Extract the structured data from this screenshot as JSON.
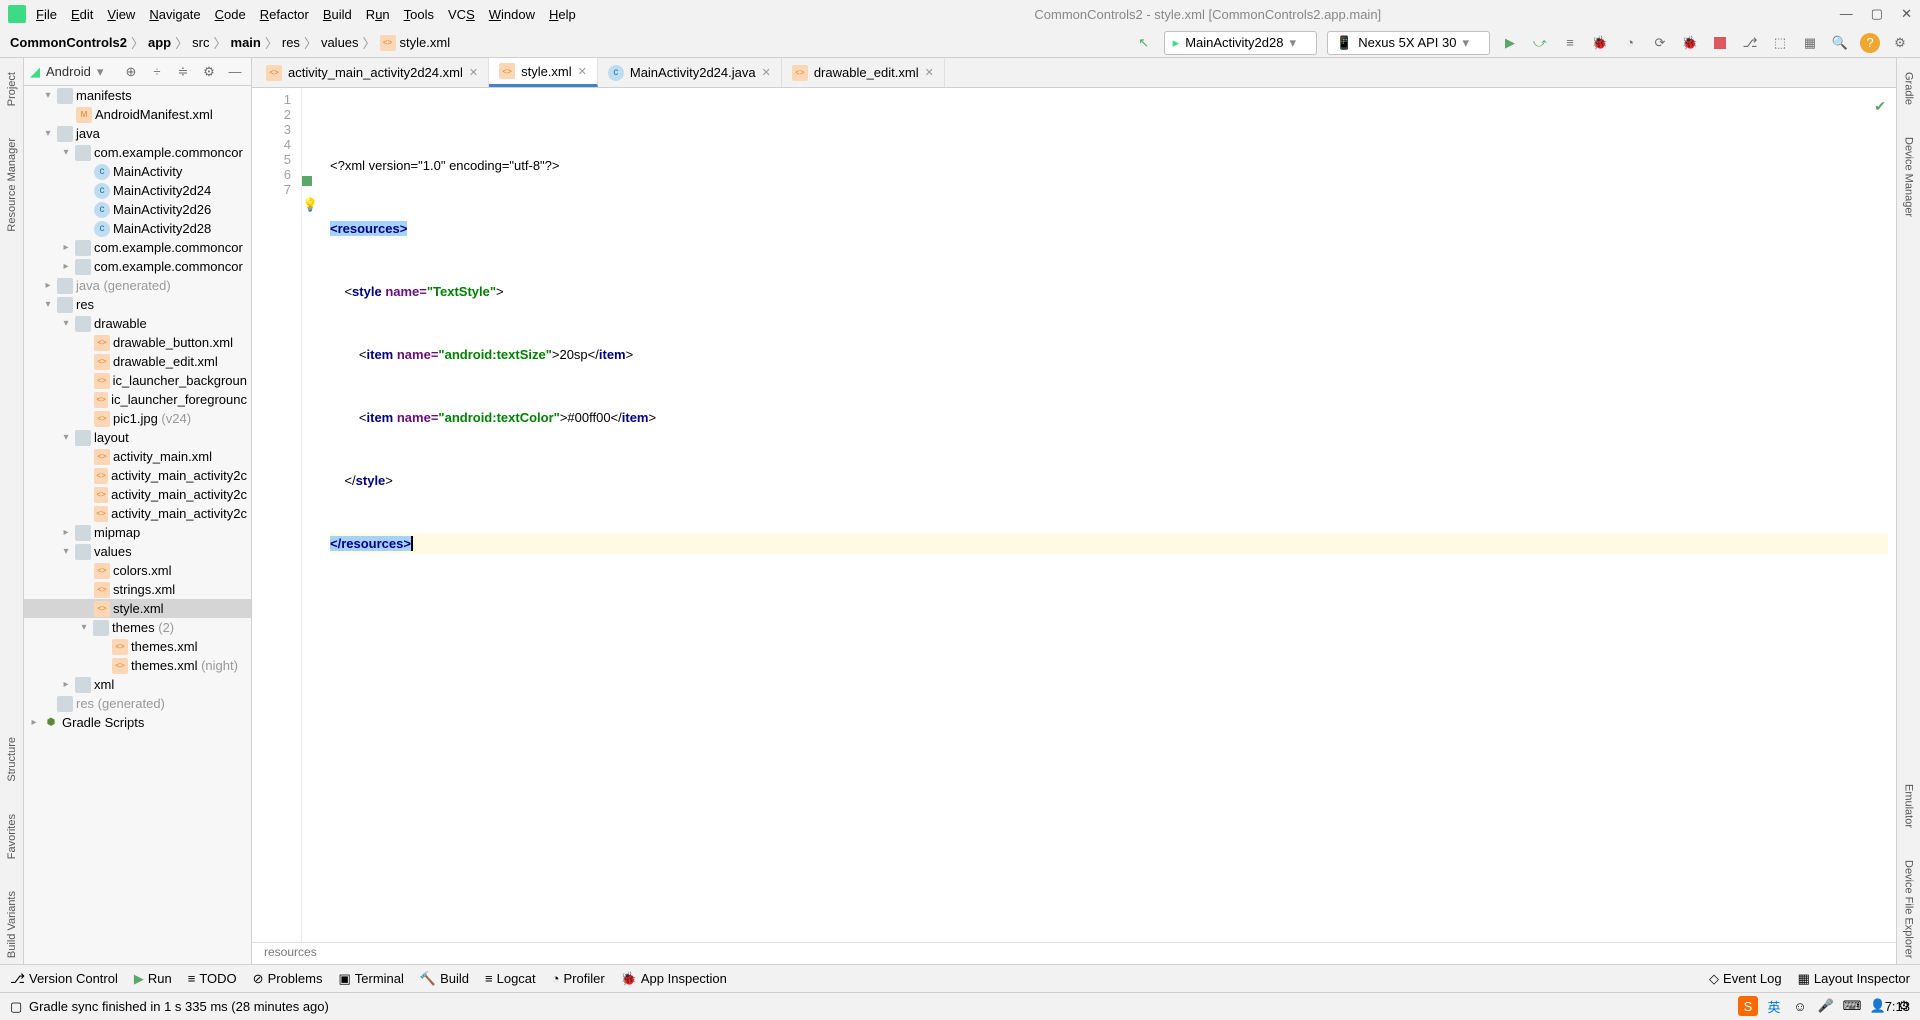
{
  "menu": [
    "File",
    "Edit",
    "View",
    "Navigate",
    "Code",
    "Refactor",
    "Build",
    "Run",
    "Tools",
    "VCS",
    "Window",
    "Help"
  ],
  "title": "CommonControls2 - style.xml [CommonControls2.app.main]",
  "breadcrumb": [
    "CommonControls2",
    "app",
    "src",
    "main",
    "res",
    "values",
    "style.xml"
  ],
  "run_config": "MainActivity2d28",
  "device": "Nexus 5X API 30",
  "panel_label": "Android",
  "tree": {
    "manifests": "manifests",
    "androidManifest": "AndroidManifest.xml",
    "java": "java",
    "pkg1": "com.example.commoncor",
    "ma": "MainActivity",
    "ma24": "MainActivity2d24",
    "ma26": "MainActivity2d26",
    "ma28": "MainActivity2d28",
    "pkg2": "com.example.commoncor",
    "pkg3": "com.example.commoncor",
    "javagen": "java",
    "javagen_suffix": " (generated)",
    "res": "res",
    "drawable": "drawable",
    "db1": "drawable_button.xml",
    "db2": "drawable_edit.xml",
    "db3": "ic_launcher_backgroun",
    "db4": "ic_launcher_foregrounc",
    "db5": "pic1.jpg",
    "db5_suffix": " (v24)",
    "layout": "layout",
    "l1": "activity_main.xml",
    "l2": "activity_main_activity2c",
    "l3": "activity_main_activity2c",
    "l4": "activity_main_activity2c",
    "mipmap": "mipmap",
    "values": "values",
    "v1": "colors.xml",
    "v2": "strings.xml",
    "v3": "style.xml",
    "themes": "themes",
    "themes_suffix": " (2)",
    "t1": "themes.xml",
    "t2": "themes.xml",
    "t2_suffix": " (night)",
    "xml": "xml",
    "resgen": "res",
    "resgen_suffix": " (generated)",
    "gradle": "Gradle Scripts"
  },
  "tabs": [
    {
      "label": "activity_main_activity2d24.xml",
      "icon": "xml",
      "active": false
    },
    {
      "label": "style.xml",
      "icon": "xml",
      "active": true
    },
    {
      "label": "MainActivity2d24.java",
      "icon": "java",
      "active": false
    },
    {
      "label": "drawable_edit.xml",
      "icon": "xml",
      "active": false
    }
  ],
  "code": {
    "l1": "<?xml version=\"1.0\" encoding=\"utf-8\"?>",
    "l2_tag": "<resources>",
    "l3_a": "    <",
    "l3_tag": "style",
    "l3_sp": " ",
    "l3_attr": "name=",
    "l3_val": "\"TextStyle\"",
    "l3_b": ">",
    "l4_a": "        <",
    "l4_tag": "item",
    "l4_sp": " ",
    "l4_attr": "name=",
    "l4_val": "\"android:textSize\"",
    "l4_b": ">",
    "l4_c": "20sp",
    "l4_d": "</",
    "l4_e": ">",
    "l5_a": "        <",
    "l5_tag": "item",
    "l5_sp": " ",
    "l5_attr": "name=",
    "l5_val": "\"android:textColor\"",
    "l5_b": ">",
    "l5_c": "#00ff00",
    "l5_d": "</",
    "l5_e": ">",
    "l6": "    </",
    "l6_tag": "style",
    "l6_b": ">",
    "l7": "</resources>"
  },
  "crumb": "resources",
  "left_rail": [
    "Project",
    "Resource Manager",
    "Structure",
    "Favorites",
    "Build Variants"
  ],
  "right_rail": [
    "Gradle",
    "Device Manager",
    "Emulator",
    "Device File Explorer"
  ],
  "bottom": {
    "vc": "Version Control",
    "run": "Run",
    "todo": "TODO",
    "problems": "Problems",
    "terminal": "Terminal",
    "build": "Build",
    "logcat": "Logcat",
    "profiler": "Profiler",
    "appinsp": "App Inspection",
    "eventlog": "Event Log",
    "layoutinsp": "Layout Inspector"
  },
  "status": {
    "msg": "Gradle sync finished in 1 s 335 ms (28 minutes ago)",
    "pos": "7:13"
  }
}
